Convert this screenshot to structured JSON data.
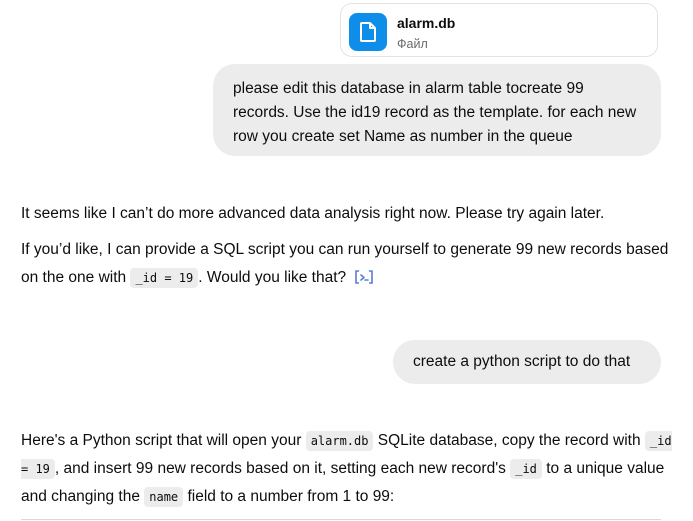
{
  "attachment": {
    "file_name": "alarm.db",
    "file_type": "Файл",
    "icon": "document-icon",
    "icon_color": "#0e8ee9"
  },
  "messages": {
    "user_1": "please edit this database in alarm table tocreate 99 records. Use the id19 record as the template. for each new row you create set Name as number in the queue",
    "assistant_1": {
      "line1": "It seems like I can’t do more advanced data analysis right now. Please try again later.",
      "line2_before": "If you’d like, I can provide a SQL script you can run yourself to generate 99 new records based on the one with ",
      "line2_code": "_id = 19",
      "line2_after": ". Would you like that?",
      "source_icon": "source-bracket-icon"
    },
    "user_2": "create a python script to do that",
    "assistant_2": {
      "t1": "Here's a Python script that will open your ",
      "c1": "alarm.db",
      "t2": " SQLite database, copy the record with ",
      "c2": "_id = 19",
      "t3": ", and insert 99 new records based on it, setting each new record's ",
      "c3": "_id",
      "t4": " to a unique value and changing the ",
      "c4": "name",
      "t5": " field to a number from 1 to 99:"
    }
  },
  "colors": {
    "user_bubble": "#ececec",
    "accent_blue": "#0e8ee9",
    "source_icon": "#5b7bd5"
  }
}
